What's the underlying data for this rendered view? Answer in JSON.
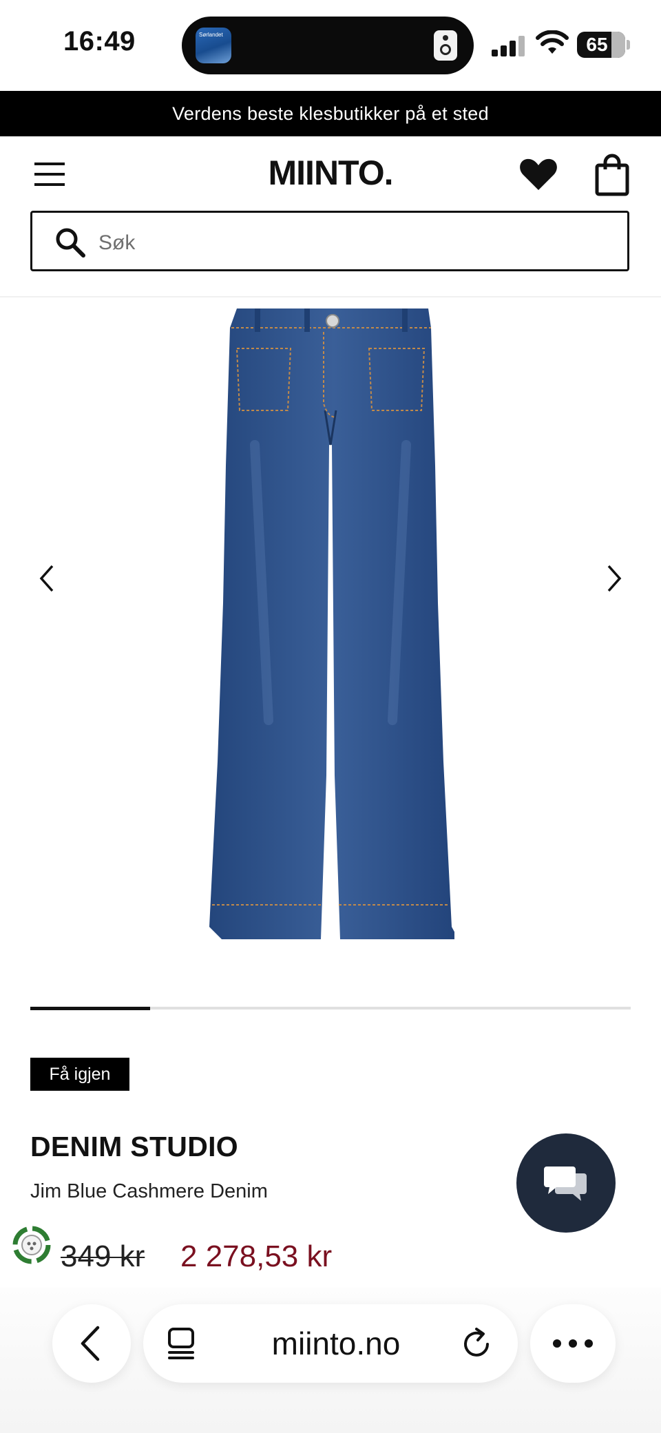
{
  "status_bar": {
    "time": "16:49",
    "island_app_label": "Sørlandet",
    "battery": "65"
  },
  "promo_banner": {
    "text": "Verdens beste klesbutikker på et sted"
  },
  "header": {
    "logo": "MIINTO.",
    "icons": {
      "menu": "hamburger-icon",
      "wishlist": "heart-icon",
      "cart": "shopping-bag-icon"
    }
  },
  "search": {
    "placeholder": "Søk",
    "value": "",
    "icon": "search-icon"
  },
  "gallery": {
    "image_alt": "Jim Blue Cashmere Denim jeans",
    "current_index": 1,
    "total_images": 5,
    "progress": 0.2
  },
  "product": {
    "badge": "Få igjen",
    "brand": "DENIM STUDIO",
    "name": "Jim Blue Cashmere Denim",
    "old_price": "349 kr",
    "new_price": "2 278,53 kr"
  },
  "colors": {
    "promo_bg": "#000000",
    "sale_price": "#7a1020",
    "chat_button": "#1f2a3c",
    "eco_badge": "#2e7d32",
    "denim": "#2c4f86"
  },
  "browser": {
    "url": "miinto.no"
  }
}
